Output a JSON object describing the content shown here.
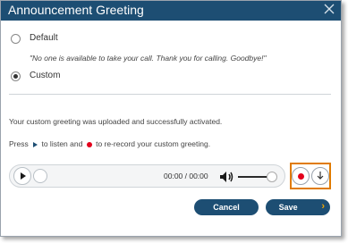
{
  "dialog": {
    "title": "Announcement Greeting",
    "options": {
      "default_label": "Default",
      "default_text": "\"No one is available to take your call. Thank you for calling. Goodbye!\"",
      "custom_label": "Custom",
      "selected": "Custom"
    },
    "status_message": "Your custom greeting was uploaded and successfully activated.",
    "instructions": {
      "part1": "Press",
      "part2": "to listen and",
      "part3": "to re-record your custom greeting."
    },
    "player": {
      "time": "00:00 / 00:00"
    },
    "buttons": {
      "cancel": "Cancel",
      "save": "Save"
    },
    "colors": {
      "titlebar": "#1d4e73",
      "record": "#e3001b",
      "highlight": "#e07b00"
    }
  }
}
